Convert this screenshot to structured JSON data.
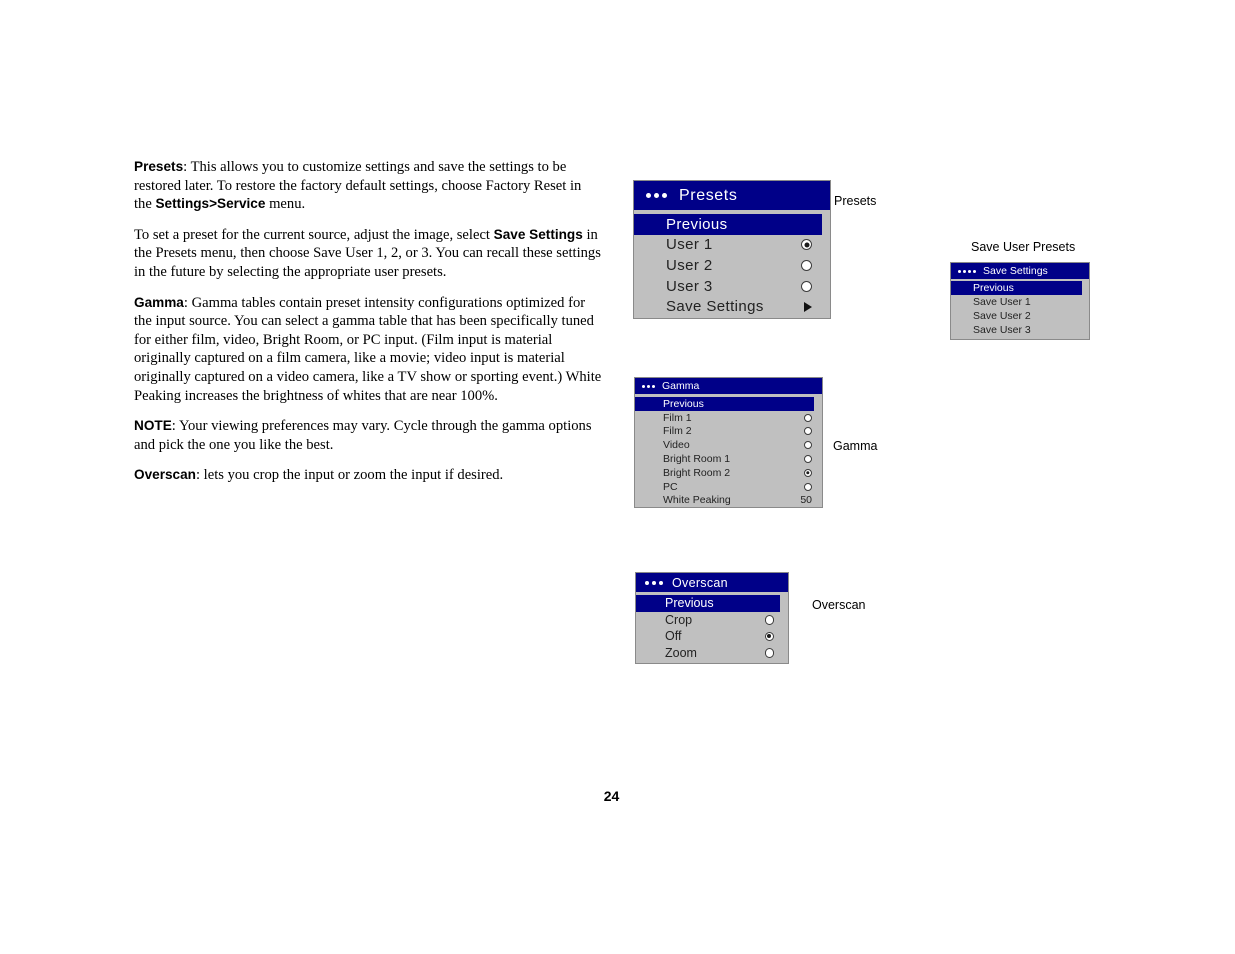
{
  "document": {
    "page_number": "24",
    "paragraphs": [
      {
        "lead": "Presets",
        "lead_sep": ": ",
        "parts": [
          {
            "text": "This allows you to customize settings and save the settings to be restored later. To restore the factory default settings, choose Factory Reset in the "
          },
          {
            "text": "Settings>Service",
            "bold": true
          },
          {
            "text": " menu."
          }
        ]
      },
      {
        "lead": "",
        "lead_sep": "",
        "parts": [
          {
            "text": "To set a preset for the current source, adjust the image, select "
          },
          {
            "text": "Save Settings",
            "bold": true
          },
          {
            "text": " in the Presets menu, then choose Save User 1, 2, or 3. You can recall these settings in the future by selecting the appropriate user presets."
          }
        ]
      },
      {
        "lead": "Gamma",
        "lead_sep": ": ",
        "parts": [
          {
            "text": "Gamma tables contain preset intensity configurations optimized for the input source. You can select a gamma table that has been specifically tuned for either film, video, Bright Room, or PC input. (Film input is material originally captured on a film camera, like a movie; video input is material originally captured on a video camera, like a TV show or sporting event.) White Peaking increases the brightness of whites that are near 100%."
          }
        ]
      },
      {
        "lead": "NOTE",
        "lead_sep": ": ",
        "parts": [
          {
            "text": "Your viewing preferences may vary. Cycle through the gamma options and pick the one you like the best."
          }
        ]
      },
      {
        "lead": "Overscan",
        "lead_sep": ": ",
        "parts": [
          {
            "text": "lets you crop the input or zoom the input if desired."
          }
        ]
      }
    ]
  },
  "colors": {
    "menu_title_blue": "#000088",
    "menu_body_gray": "#c0c0c0",
    "menu_border": "#8a8a8a",
    "highlight_blue": "#000088",
    "highlight_text": "#ffffff",
    "menu_text": "#222222",
    "page_background": "#ffffff"
  },
  "presets_menu": {
    "caption": "Presets",
    "title": "Presets",
    "breadcrumb_dots": 3,
    "rows": [
      {
        "label": "Previous",
        "highlight": true,
        "control": "none"
      },
      {
        "label": "User 1",
        "highlight": false,
        "control": "radio",
        "selected": true
      },
      {
        "label": "User 2",
        "highlight": false,
        "control": "radio",
        "selected": false
      },
      {
        "label": "User 3",
        "highlight": false,
        "control": "radio",
        "selected": false
      },
      {
        "label": "Save Settings",
        "highlight": false,
        "control": "submenu-arrow"
      }
    ]
  },
  "save_user_presets_menu": {
    "caption": "Save User Presets",
    "title": "Save Settings",
    "breadcrumb_dots": 4,
    "rows": [
      {
        "label": "Previous",
        "highlight": true,
        "control": "none"
      },
      {
        "label": "Save User 1",
        "highlight": false,
        "control": "none"
      },
      {
        "label": "Save User 2",
        "highlight": false,
        "control": "none"
      },
      {
        "label": "Save User 3",
        "highlight": false,
        "control": "none"
      }
    ]
  },
  "gamma_menu": {
    "caption": "Gamma",
    "title": "Gamma",
    "breadcrumb_dots": 3,
    "rows": [
      {
        "label": "Previous",
        "highlight": true,
        "control": "none"
      },
      {
        "label": "Film 1",
        "highlight": false,
        "control": "radio",
        "selected": false
      },
      {
        "label": "Film 2",
        "highlight": false,
        "control": "radio",
        "selected": false
      },
      {
        "label": "Video",
        "highlight": false,
        "control": "radio",
        "selected": false
      },
      {
        "label": "Bright Room 1",
        "highlight": false,
        "control": "radio",
        "selected": false
      },
      {
        "label": "Bright Room 2",
        "highlight": false,
        "control": "radio",
        "selected": true
      },
      {
        "label": "PC",
        "highlight": false,
        "control": "radio",
        "selected": false
      },
      {
        "label": "White Peaking",
        "highlight": false,
        "control": "value",
        "value": "50"
      }
    ]
  },
  "overscan_menu": {
    "caption": "Overscan",
    "title": "Overscan",
    "breadcrumb_dots": 3,
    "rows": [
      {
        "label": "Previous",
        "highlight": true,
        "control": "none"
      },
      {
        "label": "Crop",
        "highlight": false,
        "control": "radio",
        "selected": false
      },
      {
        "label": "Off",
        "highlight": false,
        "control": "radio",
        "selected": true
      },
      {
        "label": "Zoom",
        "highlight": false,
        "control": "radio",
        "selected": false
      }
    ]
  }
}
